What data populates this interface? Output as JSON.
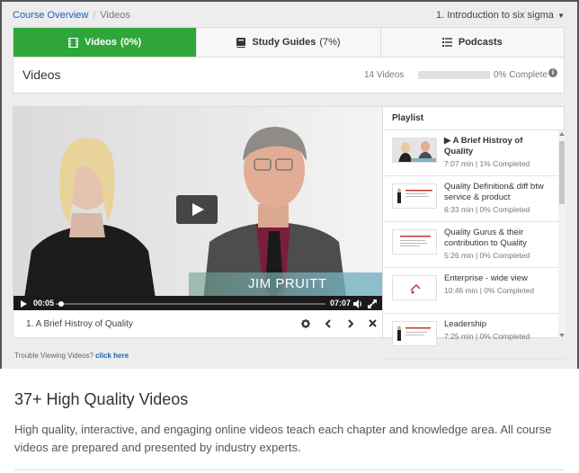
{
  "breadcrumb": {
    "home": "Course Overview",
    "current": "Videos"
  },
  "chapter_select": {
    "value": "1. Introduction to six sigma"
  },
  "tabs": [
    {
      "label": "Videos",
      "count": "(0%)",
      "icon": "film-icon",
      "active": true
    },
    {
      "label": "Study Guides",
      "count": "(7%)",
      "icon": "book-icon",
      "active": false
    },
    {
      "label": "Podcasts",
      "count": "",
      "icon": "list-icon",
      "active": false
    }
  ],
  "header": {
    "title": "Videos",
    "count": "14 Videos",
    "progress_value": 0,
    "progress_text": "0% Complete",
    "info_icon": "info-icon"
  },
  "player": {
    "lower_third": "JIM PRUITT",
    "current_time": "00:05",
    "duration": "07:07",
    "progress": 0.01,
    "title": "1. A Brief Histroy of Quality"
  },
  "playlist": {
    "heading": "Playlist",
    "items": [
      {
        "title": "▶ A Brief Histroy of Quality",
        "meta": "7:07 min | 1% Completed",
        "active": true
      },
      {
        "title": "Quality Definition& diff btw service & product",
        "meta": "6:33 min | 0% Completed",
        "active": false
      },
      {
        "title": "Quality Gurus & their contribution to Quality",
        "meta": "5:26 min | 0% Completed",
        "active": false
      },
      {
        "title": "Enterprise - wide view",
        "meta": "10:46 min | 0% Completed",
        "active": false
      },
      {
        "title": "Leadership",
        "meta": "7:25 min | 0% Completed",
        "active": false
      }
    ]
  },
  "trouble": {
    "text": "Trouble Viewing Videos?",
    "link": "click here"
  },
  "marketing": {
    "heading": "37+ High Quality Videos",
    "body": "High quality, interactive, and engaging online videos teach each chapter and knowledge area. All course videos are prepared and presented by industry experts."
  },
  "colors": {
    "accent_green": "#2ea63a",
    "link_blue": "#1f5fb4"
  }
}
